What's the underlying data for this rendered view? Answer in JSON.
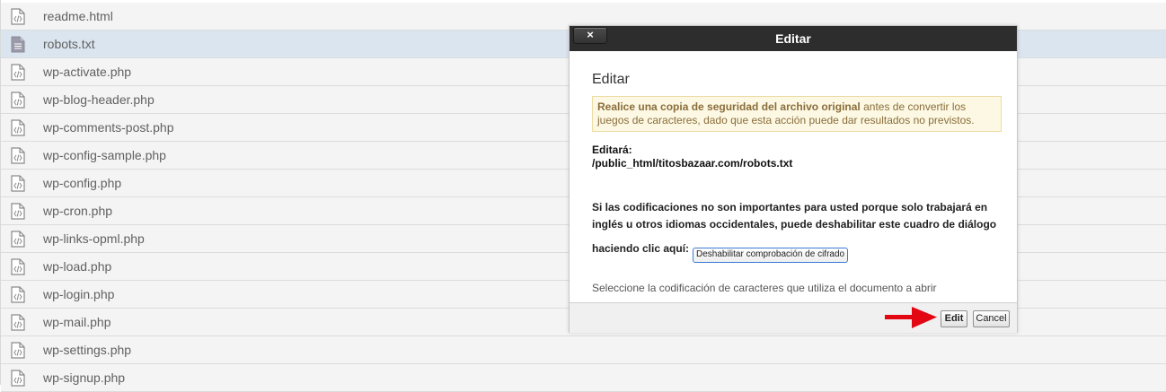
{
  "files": [
    {
      "name": "readme.html",
      "icon": "code-file-icon",
      "selected": false
    },
    {
      "name": "robots.txt",
      "icon": "text-file-icon",
      "selected": true
    },
    {
      "name": "wp-activate.php",
      "icon": "code-file-icon",
      "selected": false
    },
    {
      "name": "wp-blog-header.php",
      "icon": "code-file-icon",
      "selected": false
    },
    {
      "name": "wp-comments-post.php",
      "icon": "code-file-icon",
      "selected": false
    },
    {
      "name": "wp-config-sample.php",
      "icon": "code-file-icon",
      "selected": false
    },
    {
      "name": "wp-config.php",
      "icon": "code-file-icon",
      "selected": false
    },
    {
      "name": "wp-cron.php",
      "icon": "code-file-icon",
      "selected": false
    },
    {
      "name": "wp-links-opml.php",
      "icon": "code-file-icon",
      "selected": false
    },
    {
      "name": "wp-load.php",
      "icon": "code-file-icon",
      "selected": false
    },
    {
      "name": "wp-login.php",
      "icon": "code-file-icon",
      "selected": false
    },
    {
      "name": "wp-mail.php",
      "icon": "code-file-icon",
      "selected": false
    },
    {
      "name": "wp-settings.php",
      "icon": "code-file-icon",
      "selected": false
    },
    {
      "name": "wp-signup.php",
      "icon": "code-file-icon",
      "selected": false
    }
  ],
  "dialog": {
    "title": "Editar",
    "close_label": "×",
    "heading": "Editar",
    "warning_bold": "Realice una copia de seguridad del archivo original",
    "warning_rest": " antes de convertir los juegos de caracteres, dado que esta acción puede dar resultados no previstos.",
    "will_edit_label": "Editará:",
    "will_edit_path": "/public_html/titosbazaar.com/robots.txt",
    "para_line1": "Si las codificaciones no son importantes para usted porque solo trabajará en",
    "para_line2": "inglés u otros idiomas occidentales, puede deshabilitar este cuadro de diálogo",
    "para_line3": "haciendo clic aquí:",
    "disable_button": "Deshabilitar comprobación de cifrado",
    "cut_off_text": "Seleccione la codificación de caracteres que utiliza el documento a abrir",
    "edit_button": "Edit",
    "cancel_button": "Cancel"
  },
  "colors": {
    "header_bg": "#2d2d2d",
    "selected_row": "#dbe5ef",
    "warning_bg": "#fcf8e3",
    "arrow": "#e30613"
  }
}
